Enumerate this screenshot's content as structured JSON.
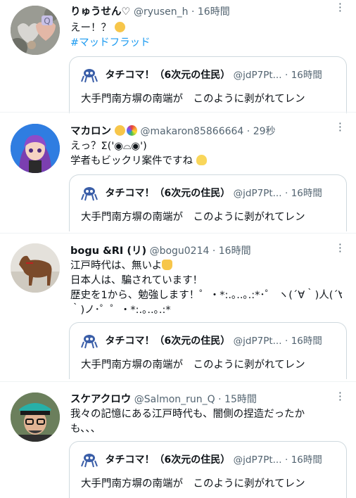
{
  "colors": {
    "accent": "#1d9bf0",
    "text": "#0f1419",
    "muted": "#536471",
    "border": "#cfd9de",
    "divider": "#eff3f4"
  },
  "tweets": [
    {
      "name": "りゅうせん♡",
      "handle": "@ryusen_h",
      "time": "16時間",
      "lines": [
        "えー！？"
      ],
      "hashtag": "#マッドフラッド",
      "quote": {
        "name": "タチコマ！（6次元の住民）",
        "handle": "@jdP7Pt...",
        "time": "16時間",
        "text": "大手門南方塀の南端が　このように剥がれてレン"
      }
    },
    {
      "name": "マカロン",
      "handle": "@makaron85866664",
      "time": "29秒",
      "lines": [
        "えっ？Σ('◉⌓◉')",
        "学者もビックリ案件ですね"
      ],
      "quote": {
        "name": "タチコマ！（6次元の住民）",
        "handle": "@jdP7Pt...",
        "time": "16時間",
        "text": "大手門南方塀の南端が　このように剥がれてレン"
      }
    },
    {
      "name": "bogu &RI (リ)",
      "handle": "@bogu0214",
      "time": "16時間",
      "lines": [
        "江戸時代は、無いよ",
        "日本人は、騙されています！",
        "歴史を1から、勉強します！゜・*:.｡..｡.:*･゜ ヽ(´∀｀)人(´∀",
        "｀)ノ･゜゜・*:.｡..｡.:*"
      ],
      "quote": {
        "name": "タチコマ！（6次元の住民）",
        "handle": "@jdP7Pt...",
        "time": "16時間",
        "text": "大手門南方塀の南端が　このように剥がれてレン"
      }
    },
    {
      "name": "スケアクロウ",
      "handle": "@Salmon_run_Q",
      "time": "15時間",
      "lines": [
        "我々の記憶にある江戸時代も、闇側の捏造だったか",
        "も、、、"
      ],
      "quote": {
        "name": "タチコマ！（6次元の住民）",
        "handle": "@jdP7Pt...",
        "time": "16時間",
        "text": "大手門南方塀の南端が　このように剥がれてレン"
      }
    }
  ]
}
